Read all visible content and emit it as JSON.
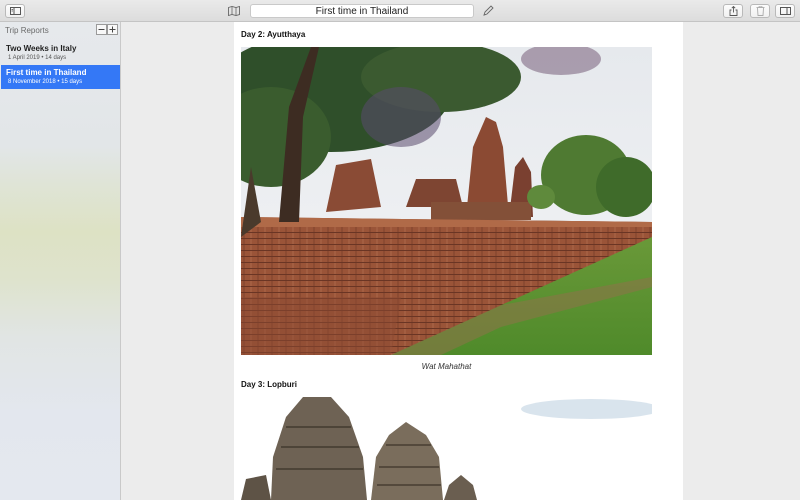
{
  "toolbar": {
    "title": "First time in Thailand"
  },
  "sidebar": {
    "title": "Trip Reports",
    "trips": [
      {
        "name": "Two Weeks in Italy",
        "meta": "1 April 2019 • 14 days",
        "selected": false
      },
      {
        "name": "First time in Thailand",
        "meta": "8 November 2018 • 15 days",
        "selected": true
      }
    ]
  },
  "document": {
    "sections": [
      {
        "heading": "Day 2: Ayutthaya",
        "caption": "Wat Mahathat"
      },
      {
        "heading": "Day 3: Lopburi"
      }
    ]
  },
  "icons": {
    "sidebar_toggle": "sidebar-toggle-icon",
    "map": "map-icon",
    "edit": "pencil-icon",
    "share": "share-icon",
    "trash": "trash-icon",
    "inspector": "inspector-panel-icon",
    "remove": "minus-icon",
    "add": "plus-icon"
  },
  "colors": {
    "selection": "#3478f6"
  }
}
